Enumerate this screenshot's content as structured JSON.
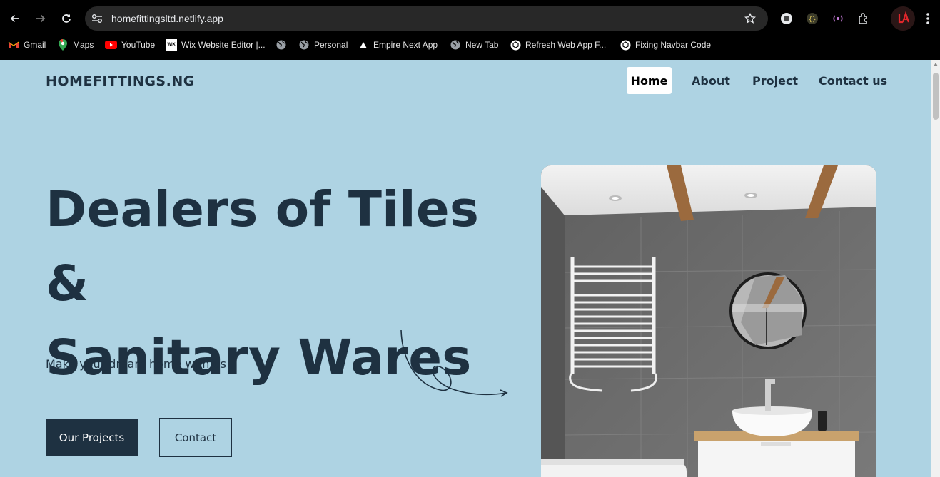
{
  "browser": {
    "url": "homefittingsltd.netlify.app",
    "bookmarks": [
      {
        "label": "Gmail",
        "icon": "gmail-icon"
      },
      {
        "label": "Maps",
        "icon": "maps-icon"
      },
      {
        "label": "YouTube",
        "icon": "youtube-icon"
      },
      {
        "label": "Wix Website Editor |...",
        "icon": "wix-icon"
      },
      {
        "label": "",
        "icon": "globe-icon"
      },
      {
        "label": "Personal",
        "icon": "globe-icon"
      },
      {
        "label": "Empire Next App",
        "icon": "triangle-icon"
      },
      {
        "label": "New Tab",
        "icon": "globe-icon"
      },
      {
        "label": "Refresh Web App F...",
        "icon": "chatgpt-icon"
      },
      {
        "label": "Fixing Navbar Code",
        "icon": "chatgpt-icon"
      }
    ]
  },
  "site": {
    "logo": "HOMEFITTINGS.NG",
    "nav": [
      {
        "label": "Home",
        "active": true
      },
      {
        "label": "About",
        "active": false
      },
      {
        "label": "Project",
        "active": false
      },
      {
        "label": "Contact us",
        "active": false
      }
    ],
    "headline_line1": "Dealers of Tiles &",
    "headline_line2": "Sanitary Wares",
    "tagline": "Make your dream home with us",
    "primary_button": "Our Projects",
    "secondary_button": "Contact",
    "hero_image_alt": "bathroom-photo"
  },
  "colors": {
    "page_bg": "#aed3e3",
    "text_dark": "#1e3141",
    "button_dark": "#1e3141"
  }
}
